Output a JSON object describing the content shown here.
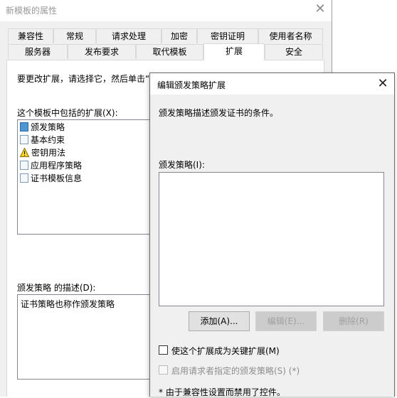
{
  "window": {
    "title": "新模板的属性"
  },
  "tabs": {
    "row1": [
      "兼容性",
      "常规",
      "请求处理",
      "加密",
      "密钥证明",
      "使用者名称"
    ],
    "row2": [
      "服务器",
      "发布要求",
      "取代模板",
      "扩展",
      "安全"
    ],
    "active": "扩展"
  },
  "panel": {
    "instruction": "要更改扩展，请选择它，然后单击“",
    "list_label": "这个模板中包括的扩展(X):",
    "extensions": [
      {
        "label": "颁发策略",
        "icon": "policy-icon"
      },
      {
        "label": "基本约束",
        "icon": "document-icon"
      },
      {
        "label": "密钥用法",
        "icon": "warning-icon"
      },
      {
        "label": "应用程序策略",
        "icon": "document-icon"
      },
      {
        "label": "证书模板信息",
        "icon": "document-icon"
      }
    ],
    "desc_label": "颁发策略 的描述(D):",
    "desc_text": "证书策略也称作颁发策略"
  },
  "dialog": {
    "title": "编辑颁发策略扩展",
    "description": "颁发策略描述颁发证书的条件。",
    "policies_label": "颁发策略(I):",
    "policies": [],
    "add_button": "添加(A)...",
    "edit_button": "编辑(E)...",
    "remove_button": "删除(R)",
    "critical_checkbox": "使这个扩展成为关键扩展(M)",
    "requester_checkbox": "启用请求者指定的颁发策略(S) (*)",
    "footnote": "* 由于兼容性设置而禁用了控件。"
  },
  "colors": {
    "window_bg": "#f0f0f0",
    "list_border": "#828790",
    "selected_icon": "#4f95d1",
    "disabled_text": "#a0a0a0"
  }
}
